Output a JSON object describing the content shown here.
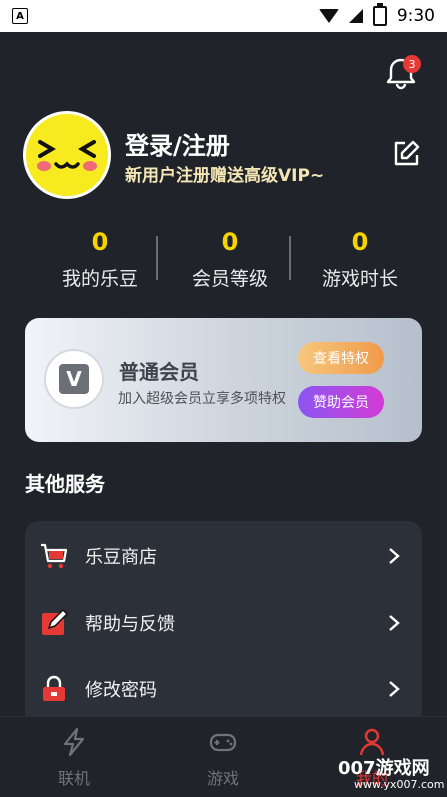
{
  "status_bar": {
    "time": "9:30",
    "left_badge": "A"
  },
  "notifications": {
    "count": "3"
  },
  "profile": {
    "title": "登录/注册",
    "subtitle": "新用户注册赠送高级VIP~"
  },
  "stats": [
    {
      "value": "0",
      "label": "我的乐豆"
    },
    {
      "value": "0",
      "label": "会员等级"
    },
    {
      "value": "0",
      "label": "游戏时长"
    }
  ],
  "vip": {
    "title": "普通会员",
    "desc": "加入超级会员立享多项特权",
    "btn_privileges": "查看特权",
    "btn_sponsor": "赞助会员",
    "logo_mark": "V",
    "colors": {
      "privileges": "#f19a4a",
      "sponsor": "#b847e4"
    }
  },
  "services": {
    "title": "其他服务",
    "items": [
      {
        "label": "乐豆商店",
        "icon": "cart-icon"
      },
      {
        "label": "帮助与反馈",
        "icon": "feedback-icon"
      },
      {
        "label": "修改密码",
        "icon": "lock-icon"
      }
    ]
  },
  "tabs": [
    {
      "label": "联机",
      "icon": "lightning-icon"
    },
    {
      "label": "游戏",
      "icon": "gamepad-icon"
    },
    {
      "label": "我的",
      "icon": "person-icon",
      "active": true
    }
  ],
  "watermark": {
    "text": "007游戏网",
    "url": "www.yx007.com"
  },
  "accent_color": "#e53935"
}
